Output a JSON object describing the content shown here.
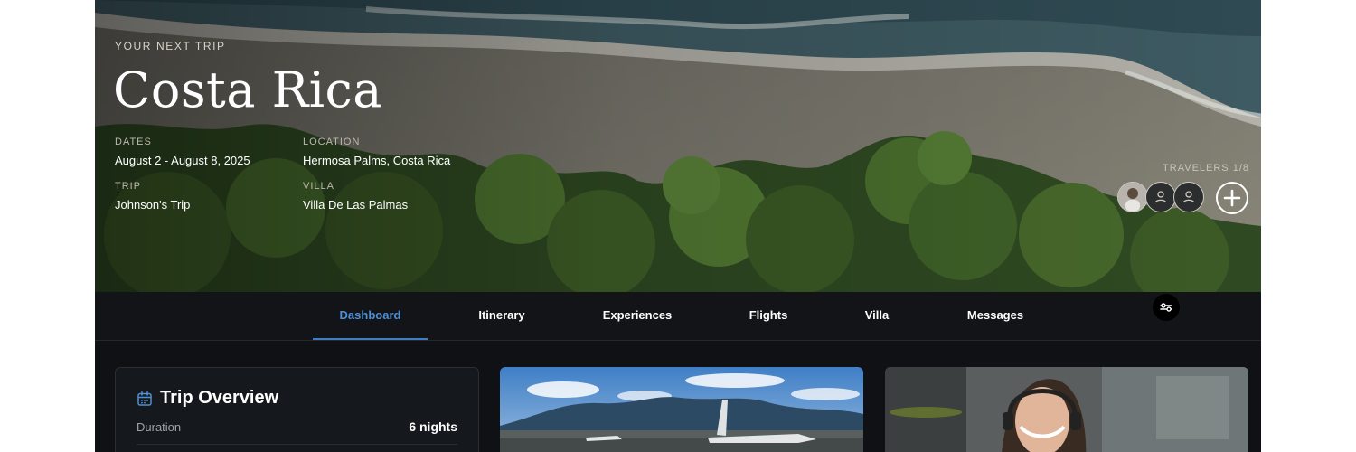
{
  "hero": {
    "kicker": "YOUR NEXT TRIP",
    "title": "Costa Rica",
    "dates": {
      "label": "DATES",
      "value": "August 2 - August 8, 2025"
    },
    "location": {
      "label": "LOCATION",
      "value": "Hermosa Palms, Costa Rica"
    },
    "trip": {
      "label": "TRIP",
      "value": "Johnson's Trip"
    },
    "villa": {
      "label": "VILLA",
      "value": "Villa De Las Palmas"
    },
    "travelers": {
      "label": "TRAVELERS 1/8",
      "avatars": [
        "photo-avatar",
        "user-icon",
        "user-icon"
      ],
      "add_icon": "plus-circle-icon"
    }
  },
  "nav": {
    "tabs": [
      {
        "label": "Dashboard",
        "active": true
      },
      {
        "label": "Itinerary",
        "active": false
      },
      {
        "label": "Experiences",
        "active": false
      },
      {
        "label": "Flights",
        "active": false
      },
      {
        "label": "Villa",
        "active": false
      },
      {
        "label": "Messages",
        "active": false
      }
    ],
    "accent_color": "#4f8fd3"
  },
  "overview": {
    "icon": "calendar-icon",
    "title": "Trip Overview",
    "duration_label": "Duration",
    "duration_value": "6 nights"
  },
  "media": [
    "airport-mountains-photo",
    "support-agent-photo"
  ]
}
